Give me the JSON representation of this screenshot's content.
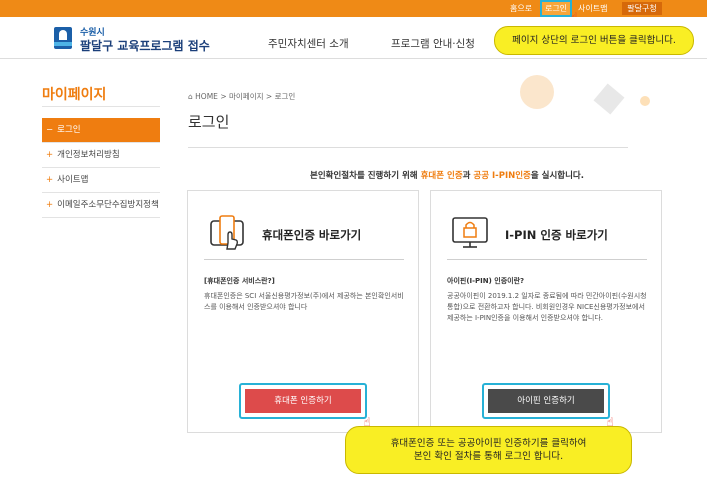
{
  "util_nav": {
    "home": "홈으로",
    "login": "로그인",
    "sitemap": "사이트맵",
    "dal": "팔달구청"
  },
  "header": {
    "city": "수원시",
    "title": "팔달구 교육프로그램 접수",
    "gnb": [
      "주민자치센터 소개",
      "프로그램 안내·신청"
    ]
  },
  "tips": {
    "top": "페이지 상단의 로그인 버튼을 클릭합니다.",
    "bottom_line1": "휴대폰인증 또는 공공아이핀 인증하기를 클릭하여",
    "bottom_line2": "본인 확인 절차를 통해 로그인 합니다."
  },
  "sidebar": {
    "title": "마이페이지",
    "items": [
      {
        "label": "로그인",
        "active": true
      },
      {
        "label": "개인정보처리방침",
        "active": false
      },
      {
        "label": "사이트맵",
        "active": false
      },
      {
        "label": "이메일주소무단수집방지정책",
        "active": false
      }
    ]
  },
  "breadcrumb": {
    "home": "HOME",
    "sep1": ">",
    "level1": "마이페이지",
    "sep2": ">",
    "level2": "로그인"
  },
  "page_title": "로그인",
  "intro": {
    "prefix": "본인확인절차를 진행하기 위해 ",
    "hl1": "휴대폰 인증",
    "mid": "과 ",
    "hl2": "공공 I-PIN인증",
    "suffix": "을 실시합니다."
  },
  "cards": {
    "phone": {
      "title": "휴대폰인증 바로가기",
      "sub": "[휴대폰인증 서비스란?]",
      "desc": "휴대폰인증은 SCI 서울신용평가정보(주)에서 제공하는 본인확인서비스를 이용해서 인증받으셔야 합니다",
      "button": "휴대폰 인증하기"
    },
    "ipin": {
      "title": "I-PIN 인증 바로가기",
      "sub": "아이핀(I-PIN) 인증이란?",
      "desc": "공공아이핀이 2019.1.2 일자로 종료됨에 따라 민간아이핀(수원시청통합)으로 전환하고자 합니다. 비회원인경우 NICE신용평가정보에서 제공하는 I-PIN인증을 이용해서 인증받으셔야 합니다.",
      "button": "아이핀 인증하기"
    }
  },
  "colors": {
    "brand_orange": "#ef7d10",
    "highlight_cyan": "#27b1d6",
    "tip_yellow": "#f9ee24",
    "phone_button": "#dd4b4b",
    "ipin_button": "#4a4a4a"
  }
}
